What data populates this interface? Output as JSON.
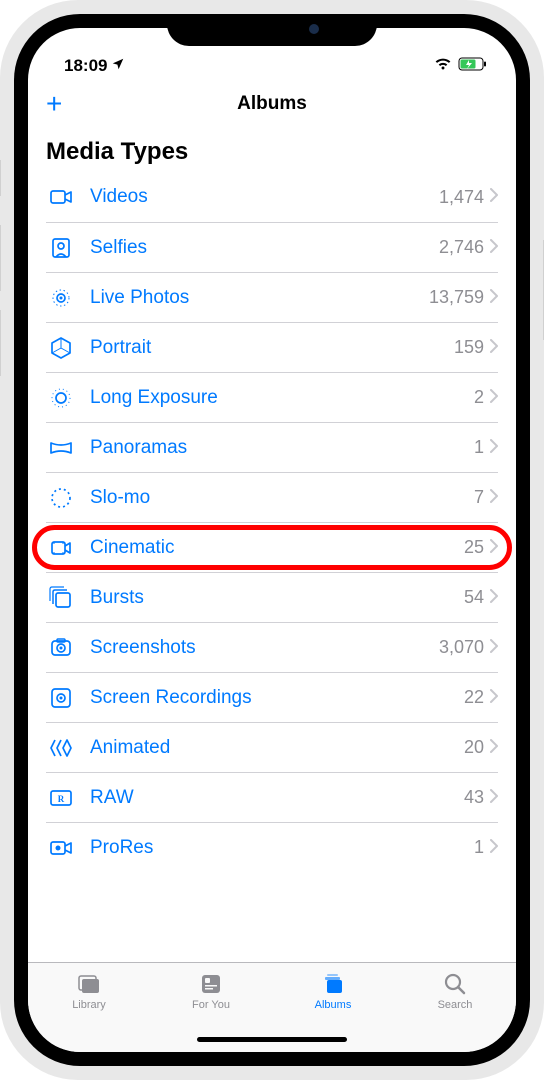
{
  "status": {
    "time": "18:09"
  },
  "nav": {
    "title": "Albums"
  },
  "section": {
    "title": "Media Types"
  },
  "rows": [
    {
      "label": "Videos",
      "count": "1,474",
      "icon": "video"
    },
    {
      "label": "Selfies",
      "count": "2,746",
      "icon": "selfie"
    },
    {
      "label": "Live Photos",
      "count": "13,759",
      "icon": "live"
    },
    {
      "label": "Portrait",
      "count": "159",
      "icon": "portrait"
    },
    {
      "label": "Long Exposure",
      "count": "2",
      "icon": "long"
    },
    {
      "label": "Panoramas",
      "count": "1",
      "icon": "pano"
    },
    {
      "label": "Slo-mo",
      "count": "7",
      "icon": "slomo"
    },
    {
      "label": "Cinematic",
      "count": "25",
      "icon": "cinematic",
      "highlighted": true
    },
    {
      "label": "Bursts",
      "count": "54",
      "icon": "bursts"
    },
    {
      "label": "Screenshots",
      "count": "3,070",
      "icon": "screenshot"
    },
    {
      "label": "Screen Recordings",
      "count": "22",
      "icon": "recording"
    },
    {
      "label": "Animated",
      "count": "20",
      "icon": "animated"
    },
    {
      "label": "RAW",
      "count": "43",
      "icon": "raw"
    },
    {
      "label": "ProRes",
      "count": "1",
      "icon": "prores"
    }
  ],
  "tabs": [
    {
      "label": "Library",
      "icon": "library",
      "active": false
    },
    {
      "label": "For You",
      "icon": "foryou",
      "active": false
    },
    {
      "label": "Albums",
      "icon": "albums",
      "active": true
    },
    {
      "label": "Search",
      "icon": "search",
      "active": false
    }
  ]
}
